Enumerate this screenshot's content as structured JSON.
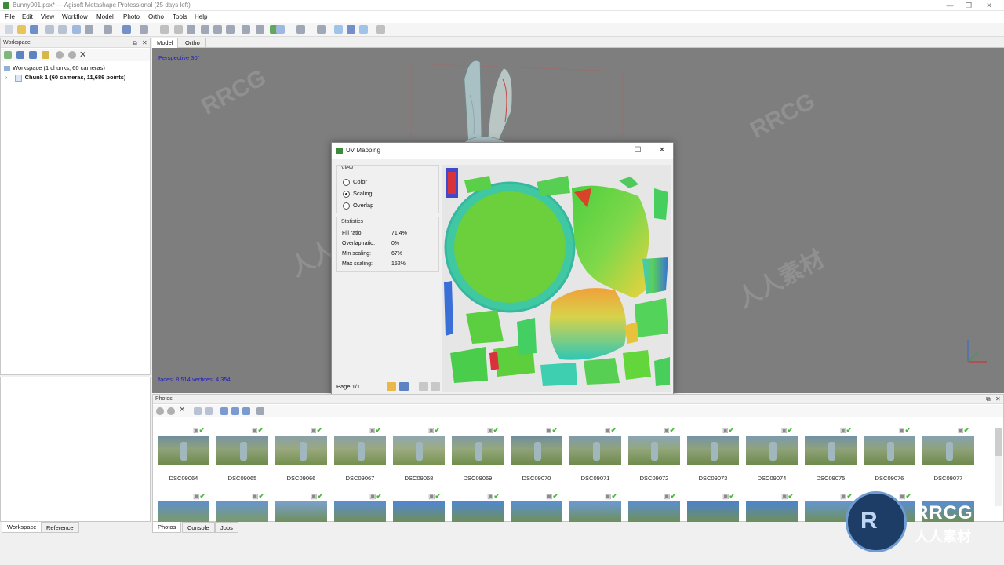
{
  "window": {
    "title": "Bunny001.psx* — Agisoft Metashape Professional (25 days left)"
  },
  "menu": [
    "File",
    "Edit",
    "View",
    "Workflow",
    "Model",
    "Photo",
    "Ortho",
    "Tools",
    "Help"
  ],
  "workspace": {
    "panel_title": "Workspace",
    "root_label": "Workspace (1 chunks, 60 cameras)",
    "chunk_label": "Chunk 1 (60 cameras, 11,686 points)"
  },
  "left_tabs": [
    "Workspace",
    "Reference"
  ],
  "viewport": {
    "tabs": [
      "Model",
      "Ortho"
    ],
    "projection_label": "Perspective 30°",
    "stats_label": "faces: 8,514 vertices: 4,354"
  },
  "uv_dialog": {
    "title": "UV Mapping",
    "view_group": "View",
    "options": [
      "Color",
      "Scaling",
      "Overlap"
    ],
    "selected": "Scaling",
    "stats_group": "Statistics",
    "stats": [
      {
        "label": "Fill ratio:",
        "value": "71.4%"
      },
      {
        "label": "Overlap ratio:",
        "value": "0%"
      },
      {
        "label": "Min scaling:",
        "value": "67%"
      },
      {
        "label": "Max scaling:",
        "value": "152%"
      }
    ],
    "page_label": "Page 1/1"
  },
  "photos": {
    "panel_title": "Photos",
    "row1": [
      "DSC09064",
      "DSC09065",
      "DSC09066",
      "DSC09067",
      "DSC09068",
      "DSC09069",
      "DSC09070",
      "DSC09071",
      "DSC09072",
      "DSC09073",
      "DSC09074",
      "DSC09075",
      "DSC09076",
      "DSC09077"
    ]
  },
  "bottom_tabs": [
    "Photos",
    "Console",
    "Jobs"
  ],
  "watermark": {
    "text_latin": "RRCG",
    "text_cn": "人人素材"
  },
  "colors": {
    "viewport_bg": "#7e7e7e",
    "check_green": "#46b83a",
    "accent_blue": "#1c1cc8"
  }
}
